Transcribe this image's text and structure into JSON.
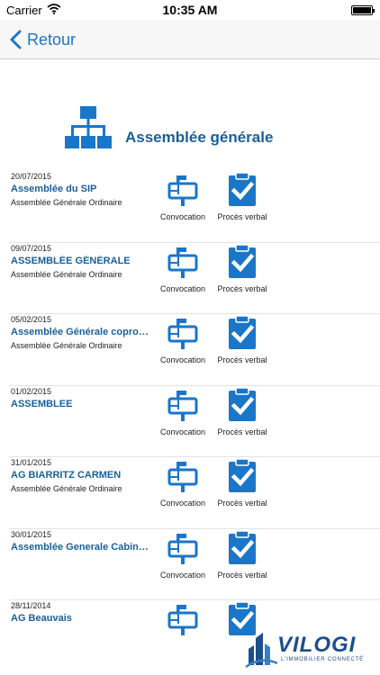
{
  "status_bar": {
    "carrier": "Carrier",
    "time": "10:35 AM"
  },
  "nav": {
    "back_label": "Retour"
  },
  "header": {
    "title": "Assemblée générale",
    "icon": "org-chart-icon"
  },
  "actions": {
    "convocation_label": "Convocation",
    "proces_verbal_label": "Procès verbal"
  },
  "meetings": [
    {
      "date": "20/07/2015",
      "title": "Assemblée du SIP",
      "subtitle": "Assemblée Générale Ordinaire"
    },
    {
      "date": "09/07/2015",
      "title": "ASSEMBLÉE GÉNÉRALE",
      "subtitle": "Assemblée Générale Ordinaire"
    },
    {
      "date": "05/02/2015",
      "title": "Assemblée Générale copropri…",
      "subtitle": "Assemblée Générale Ordinaire"
    },
    {
      "date": "01/02/2015",
      "title": "ASSEMBLEE",
      "subtitle": ""
    },
    {
      "date": "31/01/2015",
      "title": "AG BIARRITZ CARMEN",
      "subtitle": "Assemblée Générale Ordinaire"
    },
    {
      "date": "30/01/2015",
      "title": "Assemblée Generale Cabinet…",
      "subtitle": ""
    },
    {
      "date": "28/11/2014",
      "title": "AG Beauvais",
      "subtitle": ""
    }
  ],
  "logo": {
    "text": "VILOGI",
    "tagline": "L'IMMOBILIER CONNECTÉ"
  },
  "colors": {
    "accent": "#1a76c9",
    "title_blue": "#1a5f98",
    "brand": "#1b4f8a"
  }
}
